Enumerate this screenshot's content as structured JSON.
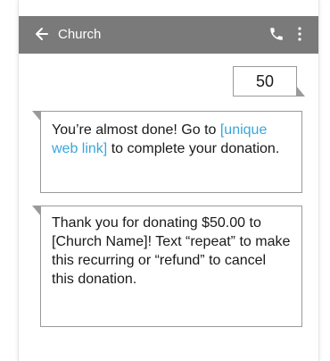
{
  "appbar": {
    "title": "Church",
    "icons": {
      "back": "back-arrow-icon",
      "call": "phone-icon",
      "more": "more-vertical-icon"
    },
    "color": "#7a7a7a"
  },
  "messages": [
    {
      "type": "sent",
      "text": "50"
    },
    {
      "type": "received",
      "parts": {
        "pre": "You’re almost done! Go to ",
        "link": "[unique web link]",
        "post": " to complete your donation."
      }
    },
    {
      "type": "received",
      "text": "Thank you for donating $50.00 to [Church Name]! Text “repeat” to make this recurring or “refund” to cancel this donation."
    }
  ],
  "colors": {
    "link": "#3aa6d9",
    "bubble_border": "#9a9a9a"
  }
}
